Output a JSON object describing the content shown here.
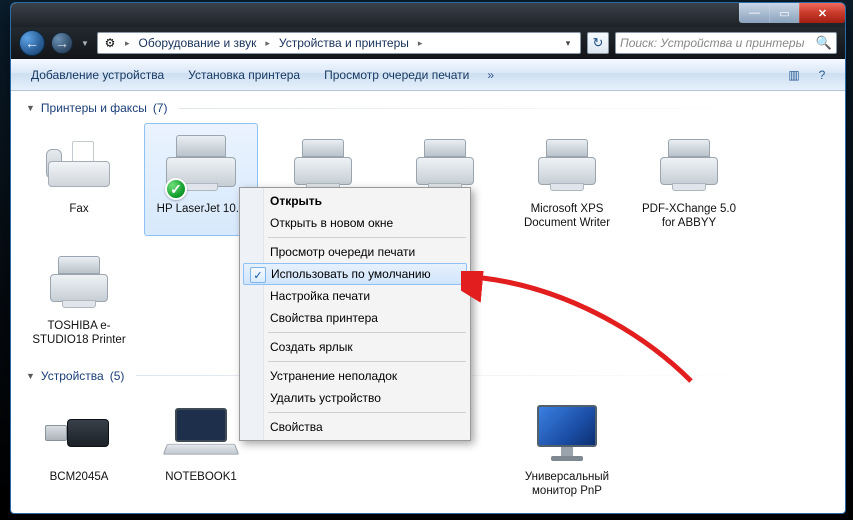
{
  "window": {
    "caption_min": "—",
    "caption_max": "▭",
    "caption_close": "✕"
  },
  "nav": {
    "back": "←",
    "forward": "→",
    "dropdown": "▼",
    "refresh": "↻",
    "address_icon": "⚙",
    "crumb1": "Оборудование и звук",
    "crumb2": "Устройства и принтеры",
    "sep": "▸",
    "addr_dd": "▾"
  },
  "search": {
    "placeholder": "Поиск: Устройства и принтеры",
    "icon": "🔍"
  },
  "cmdbar": {
    "add_device": "Добавление устройства",
    "add_printer": "Установка принтера",
    "view_queue": "Просмотр очереди печати",
    "overflow": "»",
    "view_icon": "▥",
    "help_icon": "?"
  },
  "groups": {
    "printers": {
      "label": "Принтеры и факсы",
      "count": "(7)"
    },
    "devices": {
      "label": "Устройства",
      "count": "(5)"
    }
  },
  "printers": [
    {
      "label": "Fax"
    },
    {
      "label": "HP LaserJet 10..."
    },
    {
      "label": ""
    },
    {
      "label": ""
    },
    {
      "label": "Microsoft XPS Document Writer"
    },
    {
      "label": "PDF-XChange 5.0 for ABBYY"
    },
    {
      "label": "TOSHIBA e-STUDIO18 Printer"
    }
  ],
  "devices": [
    {
      "label": "BCM2045A"
    },
    {
      "label": "NOTEBOOK1"
    },
    {
      "label": ""
    },
    {
      "label": ""
    },
    {
      "label": "Универсальный монитор PnP"
    }
  ],
  "context_menu": {
    "open": "Открыть",
    "open_new": "Открыть в новом окне",
    "view_queue": "Просмотр очереди печати",
    "set_default": "Использовать по умолчанию",
    "print_setup": "Настройка печати",
    "printer_props": "Свойства принтера",
    "create_shortcut": "Создать ярлык",
    "troubleshoot": "Устранение неполадок",
    "remove": "Удалить устройство",
    "properties": "Свойства",
    "check": "✓"
  }
}
